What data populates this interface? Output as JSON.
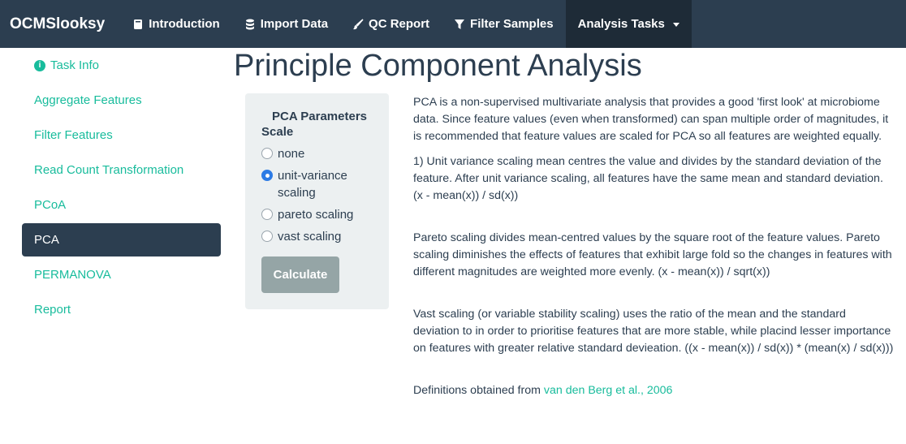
{
  "navbar": {
    "brand": "OCMSlooksy",
    "items": [
      {
        "label": "Introduction",
        "icon": "book-icon"
      },
      {
        "label": "Import Data",
        "icon": "database-icon"
      },
      {
        "label": "QC Report",
        "icon": "paint-brush-icon"
      },
      {
        "label": "Filter Samples",
        "icon": "filter-icon"
      },
      {
        "label": "Analysis Tasks",
        "icon": "caret-down-icon",
        "active": true
      }
    ]
  },
  "sidebar": {
    "items": [
      {
        "label": "Task Info",
        "icon": "info-circle-icon"
      },
      {
        "label": "Aggregate Features"
      },
      {
        "label": "Filter Features"
      },
      {
        "label": "Read Count Transformation"
      },
      {
        "label": "PCoA"
      },
      {
        "label": "PCA",
        "active": true
      },
      {
        "label": "PERMANOVA"
      },
      {
        "label": "Report"
      }
    ]
  },
  "main": {
    "title": "Principle Component Analysis",
    "panel": {
      "title": "PCA Parameters",
      "scale_label": "Scale",
      "options": [
        "none",
        "unit-variance scaling",
        "pareto scaling",
        "vast scaling"
      ],
      "selected": "unit-variance scaling",
      "calculate_label": "Calculate"
    },
    "description": {
      "p1": "PCA is a non-supervised multivariate analysis that provides a good 'first look' at microbiome data. Since feature values (even when transformed) can span multiple order of magnitudes, it is recommended that feature values are scaled for PCA so all features are weighted equally.",
      "p2": "1) Unit variance scaling mean centres the value and divides by the standard deviation of the feature. After unit variance scaling, all features have the same mean and standard deviation. (x - mean(x)) / sd(x))",
      "p3": "Pareto scaling divides mean-centred values by the square root of the feature values. Pareto scaling diminishes the effects of features that exhibit large fold so the changes in features with different magnitudes are weighted more evenly. (x - mean(x)) / sqrt(x))",
      "p4": "Vast scaling (or variable stability scaling) uses the ratio of the mean and the standard deviation to in order to prioritise features that are more stable, while placind lesser importance on features with greater relative standard devieation. ((x - mean(x)) / sd(x)) * (mean(x) / sd(x)))",
      "definitions_prefix": "Definitions obtained from",
      "definitions_link": "van den Berg et al., 2006"
    }
  },
  "colors": {
    "navbar": "#2c3e50",
    "accent": "#18bc9c",
    "panel": "#ecf0f1",
    "button": "#95a5a6",
    "radio_selected": "#2c7be5"
  }
}
